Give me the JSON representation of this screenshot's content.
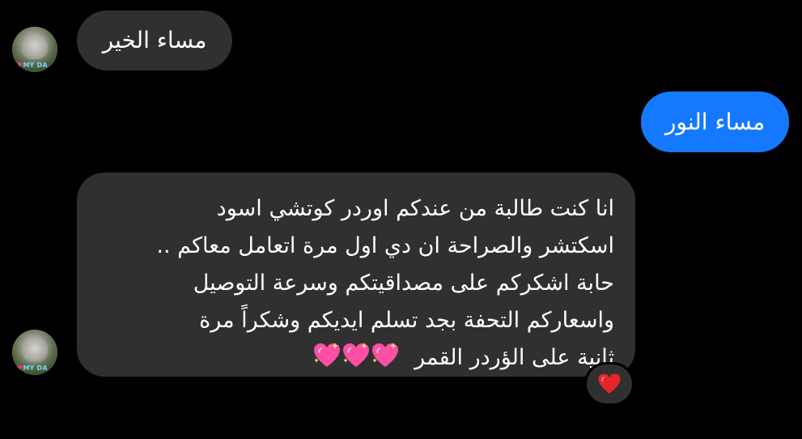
{
  "messages": [
    {
      "id": "msg1",
      "direction": "incoming",
      "text": "مساء الخير",
      "avatar": {
        "icon": "user-avatar",
        "badge_text": "MY DA"
      }
    },
    {
      "id": "msg2",
      "direction": "outgoing",
      "text": "مساء النور"
    },
    {
      "id": "msg3",
      "direction": "incoming",
      "lines": [
        "انا كنت طالبة من عندكم اوردر كوتشي اسود",
        "اسكتشر والصراحة ان دي اول مرة اتعامل معاكم ..",
        "حابة اشكركم على مصداقيتكم وسرعة التوصيل",
        "واسعاركم التحفة بجد تسلم ايديكم وشكراً مرة",
        "ثانية على الؤردر القمر"
      ],
      "emoji_icons": [
        "sparkling-heart-icon",
        "sparkling-heart-icon",
        "sparkling-heart-icon"
      ],
      "reaction_icon": "red-heart-icon",
      "avatar": {
        "icon": "user-avatar",
        "badge_text": "MY DA"
      }
    }
  ],
  "colors": {
    "background": "#000000",
    "incoming_bubble": "#303030",
    "outgoing_bubble": "#1479ff",
    "text": "#ffffff",
    "heart": "#e5252a",
    "sparkle_heart": "#ff4fa3"
  }
}
